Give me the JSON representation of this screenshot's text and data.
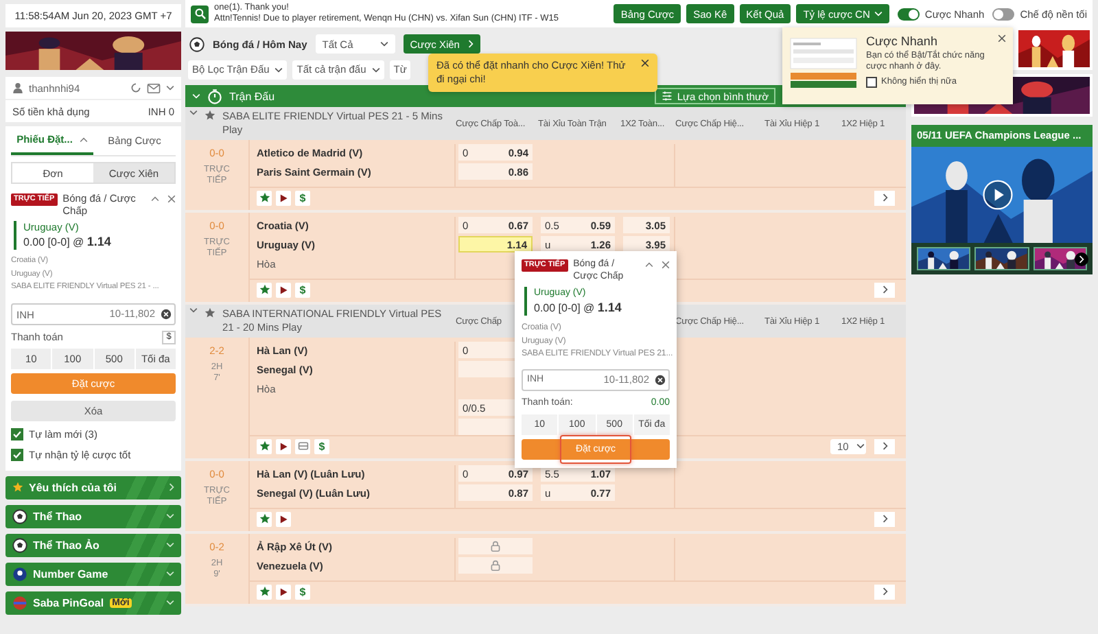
{
  "clock": "11:58:54AM Jun 20, 2023 GMT +7",
  "account": {
    "username": "thanhnhi94",
    "balance_label": "Số tiền khả dụng",
    "balance": "INH 0"
  },
  "slip_tabs": [
    {
      "label": "Phiếu Đặt...",
      "selected": true
    },
    {
      "label": "Bảng Cược",
      "selected": false
    }
  ],
  "bet_types": [
    {
      "label": "Đơn",
      "selected": true
    },
    {
      "label": "Cược Xiên",
      "selected": false
    }
  ],
  "bet_slip": {
    "live_badge": "TRỰC TIẾP",
    "market": "Bóng đá / Cược Chấp",
    "selection": "Uruguay (V)",
    "line": "0.00 [0-0] @ **1.14**",
    "home": "Croatia (V)",
    "away": "Uruguay (V)",
    "league": "SABA ELITE FRIENDLY Virtual PES 21 - ...",
    "currency": "INH",
    "stake_placeholder": "10-11,802",
    "payout_label": "Thanh toán",
    "currency_button": "$",
    "quick_stakes": [
      "10",
      "100",
      "500",
      "Tối đa"
    ],
    "place_button": {
      "label": "Đặt cược"
    },
    "clear_button": "Xóa"
  },
  "options": [
    {
      "label": "Tự làm mới (3)",
      "checked": true
    },
    {
      "label": "Tự nhận tỷ lệ cược tốt",
      "checked": true
    }
  ],
  "menu": [
    {
      "label": "Yêu thích của tôi",
      "kind": "link"
    },
    {
      "label": "Thể Thao",
      "kind": "group"
    },
    {
      "label": "Thể Thao Ảo",
      "kind": "group"
    },
    {
      "label": "Number Game",
      "kind": "group"
    },
    {
      "label": "Saba PinGoal",
      "badge": "Mới",
      "kind": "group"
    }
  ],
  "ticker": [
    "one(1). Thank you!",
    "Attn!Tennis! Due to player retirement, Wenqn Hu (CHN) vs. Xifan Sun (CHN) ITF - W15"
  ],
  "top_buttons": [
    {
      "label": "Bảng Cược",
      "kind": "button"
    },
    {
      "label": "Sao Kê",
      "kind": "button"
    },
    {
      "label": "Kết Quả",
      "kind": "button"
    },
    {
      "label": "Tỷ lệ cược CN",
      "kind": "dropdown"
    }
  ],
  "toggles": [
    {
      "label": "Cược Nhanh",
      "on": true
    },
    {
      "label": "Chế độ nền tối",
      "on": false
    }
  ],
  "sport_bar": {
    "title": "Bóng đá / Hôm Nay",
    "market_select": "Tất Cả",
    "parlay_button": "Cược Xiên"
  },
  "filters": [
    "Bộ Lọc Trận Đấu",
    "Tất cả trận đấu",
    "Từ"
  ],
  "parlay_tip": {
    "text": "Đã có thể đặt nhanh cho Cược Xiên! Thử đi ngại chi!"
  },
  "section": {
    "title": "Trận Đấu",
    "view_button": "Lựa chọn bình thườ"
  },
  "quick_bet_popover": {
    "title": "Cược Nhanh",
    "text": "Bạn có thể Bật/Tắt chức năng cược nhanh ở đây.",
    "checkbox": {
      "label": "Không hiển thị nữa",
      "checked": false
    }
  },
  "leagues": [
    {
      "name": "SABA ELITE FRIENDLY Virtual PES 21 - 5 Mins Play",
      "columns": [
        "Cược Chấp Toà...",
        "Tài Xỉu Toàn Trận",
        "1X2 Toàn...",
        "Cược Chấp Hiệ...",
        "Tài Xỉu Hiệp 1",
        "1X2 Hiệp 1"
      ],
      "matches": [
        {
          "score": "0-0",
          "status": [
            "TRỰC",
            "TIẾP"
          ],
          "teams": [
            "Atletico de Madrid (V)",
            "Paris Saint Germain (V)"
          ],
          "handicap": [
            [
              {
                "line": "0",
                "odds": "0.94",
                "selected": false
              },
              {
                "odds": "0.86",
                "selected": false
              }
            ]
          ],
          "tools": [
            {
              "kind": "favorite"
            },
            {
              "kind": "live"
            },
            {
              "kind": "cashout",
              "label": "$"
            }
          ]
        },
        {
          "score": "0-0",
          "status": [
            "TRỰC",
            "TIẾP"
          ],
          "teams": [
            "Croatia (V)",
            "Uruguay (V)"
          ],
          "draw": "Hòa",
          "handicap": [
            [
              {
                "line": "0",
                "odds": "0.67",
                "selected": false
              },
              {
                "odds": "1.14",
                "selected": true
              }
            ]
          ],
          "over_under": [
            [
              {
                "line": "0.5",
                "odds": "0.59",
                "selected": false
              },
              {
                "line": "u",
                "odds": "1.26",
                "selected": false
              }
            ]
          ],
          "one_x_two": [
            [
              {
                "odds": "3.05",
                "selected": false
              },
              {
                "odds": "3.95",
                "selected": false
              }
            ]
          ],
          "tools": [
            {
              "kind": "favorite"
            },
            {
              "kind": "live"
            },
            {
              "kind": "cashout",
              "label": "$"
            }
          ]
        }
      ]
    },
    {
      "name": "SABA INTERNATIONAL FRIENDLY Virtual PES 21 - 20 Mins Play",
      "columns": [
        "Cược Chấp",
        null,
        null,
        "Cược Chấp Hiệ...",
        "Tài Xỉu Hiệp 1",
        "1X2 Hiệp 1"
      ],
      "matches": [
        {
          "score": "2-2",
          "status": [
            "2H",
            "7'"
          ],
          "teams": [
            "Hà Lan (V)",
            "Senegal (V)"
          ],
          "draw": "Hòa",
          "handicap": [
            [
              {
                "line": "0",
                "selected": false
              },
              {
                "selected": false
              }
            ],
            [
              {
                "line": "0/0.5",
                "selected": false
              },
              {
                "selected": false
              }
            ]
          ],
          "tools": [
            {
              "kind": "favorite"
            },
            {
              "kind": "live"
            },
            {
              "kind": "tv"
            },
            {
              "kind": "cashout",
              "label": "$"
            }
          ],
          "page_size": "10"
        },
        {
          "score": "0-0",
          "status": [
            "TRỰC",
            "TIẾP"
          ],
          "teams": [
            "Hà Lan (V) (Luân Lưu)",
            "Senegal (V) (Luân Lưu)"
          ],
          "handicap": [
            [
              {
                "line": "0",
                "odds": "0.97",
                "selected": false
              },
              {
                "odds": "0.87",
                "selected": false
              }
            ]
          ],
          "over_under": [
            [
              {
                "line": "5.5",
                "odds": "1.07",
                "selected": false
              },
              {
                "line": "u",
                "odds": "0.77",
                "selected": false
              }
            ]
          ],
          "tools": [
            {
              "kind": "favorite"
            },
            {
              "kind": "live"
            }
          ]
        },
        {
          "score": "0-2",
          "status": [
            "2H",
            "9'"
          ],
          "teams": [
            "Ả Rập Xê Út (V)",
            "Venezuela (V)"
          ],
          "handicap": [
            [
              {
                "kind": "locked"
              },
              {
                "kind": "locked"
              }
            ]
          ],
          "tools": [
            {
              "kind": "favorite"
            },
            {
              "kind": "live"
            },
            {
              "kind": "cashout",
              "label": "$"
            }
          ]
        }
      ]
    }
  ],
  "highlights": {
    "title": "05/11 UEFA Champions League ..."
  },
  "quick_bet": {
    "live_badge": "TRỰC TIẾP",
    "market": "Bóng đá / Cược Chấp",
    "selection": "Uruguay (V)",
    "line": "0.00 [0-0] @ **1.14**",
    "home": "Croatia (V)",
    "away": "Uruguay (V)",
    "league": "SABA ELITE FRIENDLY Virtual PES 21...",
    "currency": "INH",
    "stake_placeholder": "10-11,802",
    "payout_label": "Thanh toán:",
    "payout_value": "0.00",
    "quick_stakes": [
      "10",
      "100",
      "500",
      "Tối đa"
    ],
    "place_button": {
      "label": "Đặt cược",
      "highlighted": true
    }
  }
}
